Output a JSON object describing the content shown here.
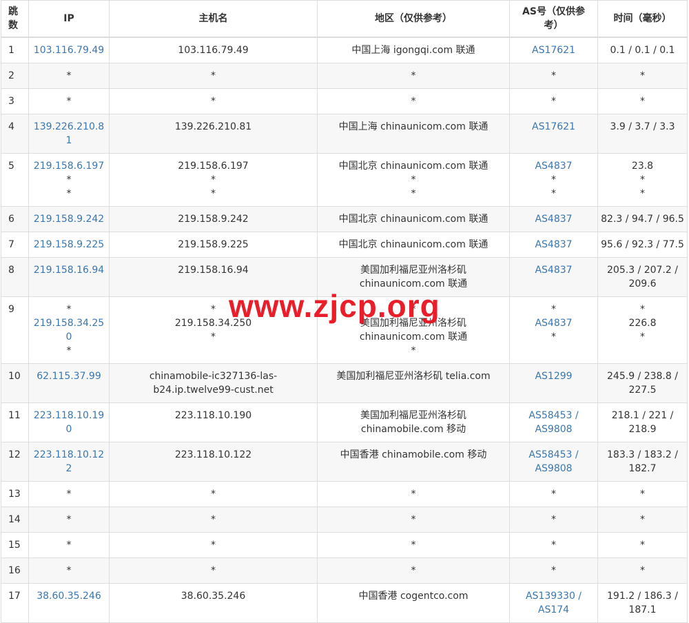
{
  "headers": {
    "hop": "跳数",
    "ip": "IP",
    "hostname": "主机名",
    "region": "地区（仅供参考）",
    "as": "AS号（仅供参考）",
    "time": "时间（毫秒）"
  },
  "rows": [
    {
      "hop": "1",
      "ip": [
        "103.116.79.49"
      ],
      "host": [
        "103.116.79.49"
      ],
      "region": [
        "中国上海 igongqi.com 联通"
      ],
      "as": [
        "AS17621"
      ],
      "time": [
        "0.1 / 0.1 / 0.1"
      ]
    },
    {
      "hop": "2",
      "ip": [
        "*"
      ],
      "host": [
        "*"
      ],
      "region": [
        "*"
      ],
      "as": [
        "*"
      ],
      "time": [
        "*"
      ]
    },
    {
      "hop": "3",
      "ip": [
        "*"
      ],
      "host": [
        "*"
      ],
      "region": [
        "*"
      ],
      "as": [
        "*"
      ],
      "time": [
        "*"
      ]
    },
    {
      "hop": "4",
      "ip": [
        "139.226.210.81"
      ],
      "host": [
        "139.226.210.81"
      ],
      "region": [
        "中国上海 chinaunicom.com 联通"
      ],
      "as": [
        "AS17621"
      ],
      "time": [
        "3.9 / 3.7 / 3.3"
      ]
    },
    {
      "hop": "5",
      "ip": [
        "219.158.6.197",
        "*",
        "*"
      ],
      "host": [
        "219.158.6.197",
        "*",
        "*"
      ],
      "region": [
        "中国北京 chinaunicom.com 联通",
        "*",
        "*"
      ],
      "as": [
        "AS4837",
        "*",
        "*"
      ],
      "time": [
        "23.8",
        "*",
        "*"
      ]
    },
    {
      "hop": "6",
      "ip": [
        "219.158.9.242"
      ],
      "host": [
        "219.158.9.242"
      ],
      "region": [
        "中国北京 chinaunicom.com 联通"
      ],
      "as": [
        "AS4837"
      ],
      "time": [
        "82.3 / 94.7 / 96.5"
      ]
    },
    {
      "hop": "7",
      "ip": [
        "219.158.9.225"
      ],
      "host": [
        "219.158.9.225"
      ],
      "region": [
        "中国北京 chinaunicom.com 联通"
      ],
      "as": [
        "AS4837"
      ],
      "time": [
        "95.6 / 92.3 / 77.5"
      ]
    },
    {
      "hop": "8",
      "ip": [
        "219.158.16.94"
      ],
      "host": [
        "219.158.16.94"
      ],
      "region": [
        "美国加利福尼亚州洛杉矶",
        "chinaunicom.com 联通"
      ],
      "as": [
        "AS4837"
      ],
      "time": [
        "205.3 / 207.2 /",
        "209.6"
      ]
    },
    {
      "hop": "9",
      "ip": [
        "*",
        "219.158.34.250",
        "*"
      ],
      "host": [
        "*",
        "219.158.34.250",
        "*"
      ],
      "region": [
        "*",
        "美国加利福尼亚州洛杉矶",
        "chinaunicom.com 联通",
        "*"
      ],
      "as": [
        "*",
        "AS4837",
        "*"
      ],
      "time": [
        "*",
        "226.8",
        "*"
      ]
    },
    {
      "hop": "10",
      "ip": [
        "62.115.37.99"
      ],
      "host": [
        "chinamobile-ic327136-las-",
        "b24.ip.twelve99-cust.net"
      ],
      "region": [
        "美国加利福尼亚州洛杉矶 telia.com"
      ],
      "as": [
        "AS1299"
      ],
      "time": [
        "245.9 / 238.8 /",
        "227.5"
      ]
    },
    {
      "hop": "11",
      "ip": [
        "223.118.10.190"
      ],
      "host": [
        "223.118.10.190"
      ],
      "region": [
        "美国加利福尼亚州洛杉矶",
        "chinamobile.com 移动"
      ],
      "as": [
        "AS58453 /",
        "AS9808"
      ],
      "time": [
        "218.1 / 221 /",
        "218.9"
      ]
    },
    {
      "hop": "12",
      "ip": [
        "223.118.10.122"
      ],
      "host": [
        "223.118.10.122"
      ],
      "region": [
        "中国香港 chinamobile.com 移动"
      ],
      "as": [
        "AS58453 /",
        "AS9808"
      ],
      "time": [
        "183.3 / 183.2 /",
        "182.7"
      ]
    },
    {
      "hop": "13",
      "ip": [
        "*"
      ],
      "host": [
        "*"
      ],
      "region": [
        "*"
      ],
      "as": [
        "*"
      ],
      "time": [
        "*"
      ]
    },
    {
      "hop": "14",
      "ip": [
        "*"
      ],
      "host": [
        "*"
      ],
      "region": [
        "*"
      ],
      "as": [
        "*"
      ],
      "time": [
        "*"
      ]
    },
    {
      "hop": "15",
      "ip": [
        "*"
      ],
      "host": [
        "*"
      ],
      "region": [
        "*"
      ],
      "as": [
        "*"
      ],
      "time": [
        "*"
      ]
    },
    {
      "hop": "16",
      "ip": [
        "*"
      ],
      "host": [
        "*"
      ],
      "region": [
        "*"
      ],
      "as": [
        "*"
      ],
      "time": [
        "*"
      ]
    },
    {
      "hop": "17",
      "ip": [
        "38.60.35.246"
      ],
      "host": [
        "38.60.35.246"
      ],
      "region": [
        "中国香港 cogentco.com"
      ],
      "as": [
        "AS139330 /",
        "AS174"
      ],
      "time": [
        "191.2 / 186.3 /",
        "187.1"
      ]
    }
  ],
  "watermark": "www.zjcp.org",
  "colors": {
    "link": "#3a76b0",
    "watermark": "#e8121f",
    "stripe": "#f7f7f7",
    "border": "#dddddd"
  }
}
